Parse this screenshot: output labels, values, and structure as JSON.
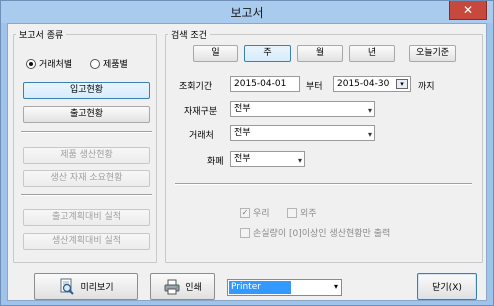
{
  "window": {
    "title": "보고서",
    "close_label": "✕"
  },
  "report_type": {
    "legend": "보고서 종류",
    "radio_options": [
      {
        "label": "거래처별",
        "selected": true
      },
      {
        "label": "제품별",
        "selected": false
      }
    ],
    "buttons": [
      {
        "label": "입고현황",
        "enabled": true,
        "selected": true
      },
      {
        "label": "출고현황",
        "enabled": true,
        "selected": false
      },
      {
        "label": "제품 생산현황",
        "enabled": false
      },
      {
        "label": "생산 자재 소요현황",
        "enabled": false
      },
      {
        "label": "출고계획대비 실적",
        "enabled": false
      },
      {
        "label": "생산계획대비 실적",
        "enabled": false
      }
    ]
  },
  "search": {
    "legend": "검색 조건",
    "period_tabs": [
      "일",
      "주",
      "월",
      "년"
    ],
    "selected_period": "주",
    "today_button": "오늘기준",
    "date_label": "조회기간",
    "date_from": "2015-04-01",
    "from_suffix": "부터",
    "date_to": "2015-04-30",
    "to_suffix": "까지",
    "material_label": "자재구분",
    "material_value": "전부",
    "vendor_label": "거래처",
    "vendor_value": "전부",
    "currency_label": "화폐",
    "currency_value": "전부",
    "checks": {
      "ours": {
        "label": "우리",
        "checked": true,
        "enabled": false
      },
      "outsource": {
        "label": "외주",
        "checked": false,
        "enabled": false
      },
      "loss_only": {
        "label": "손실량이 [0]이상인 생산현황만 출력",
        "checked": false,
        "enabled": false
      }
    }
  },
  "footer": {
    "preview_label": "미리보기",
    "print_label": "인쇄",
    "printer_value": "Printer",
    "close_label": "닫기(X)"
  }
}
